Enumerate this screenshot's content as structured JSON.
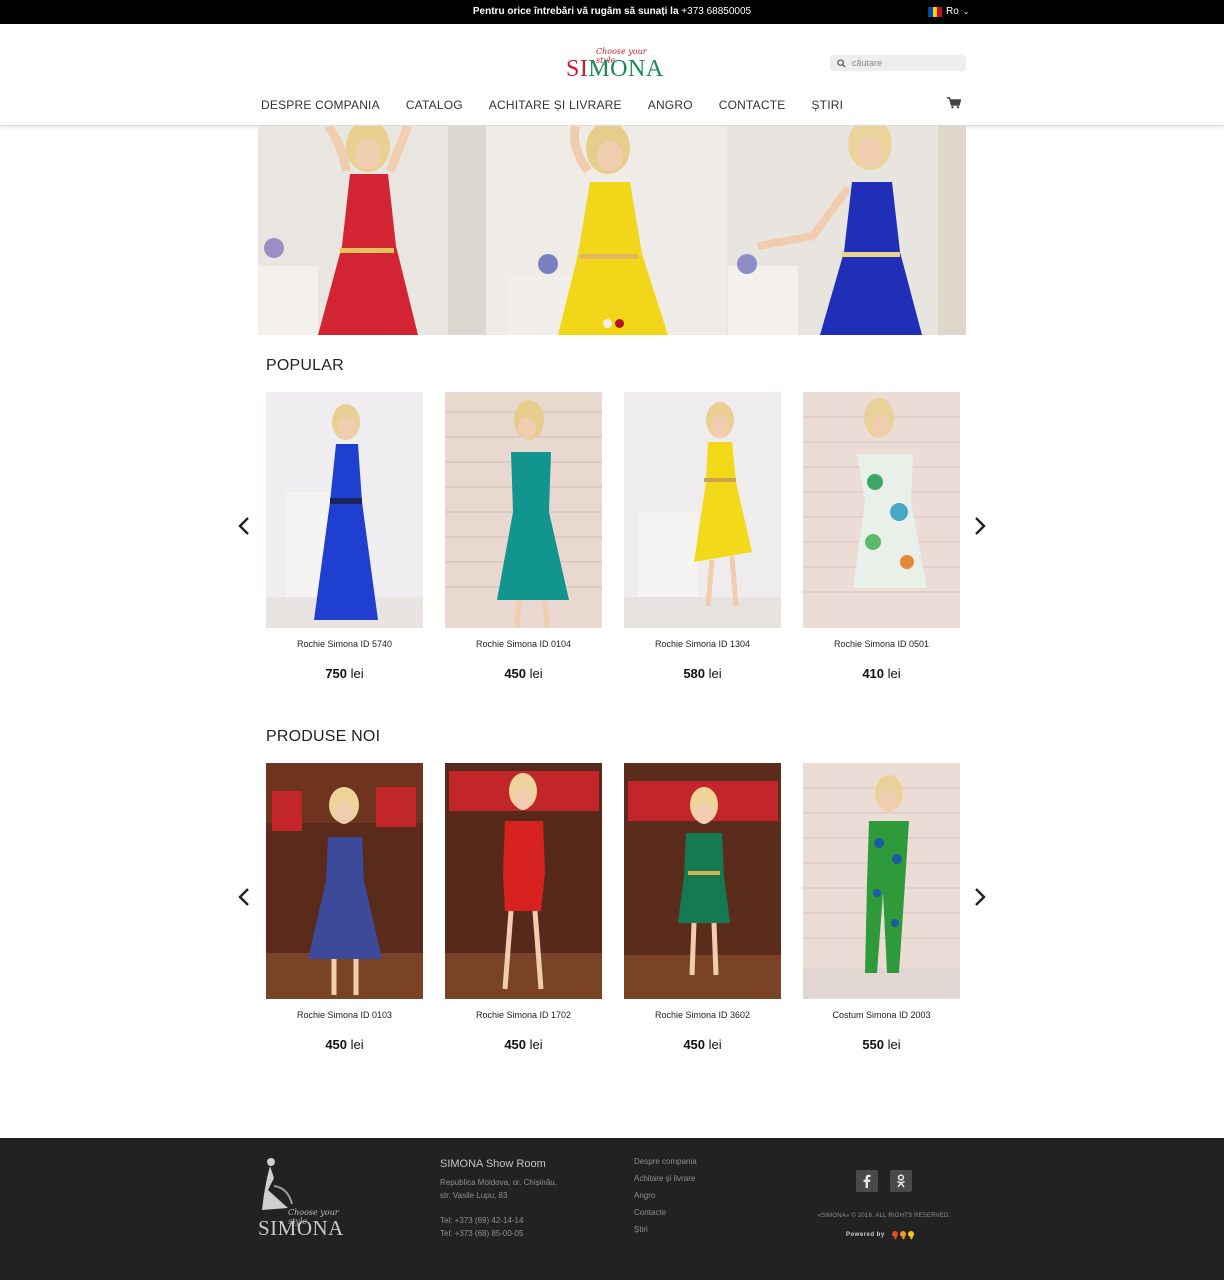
{
  "topbar": {
    "message": "Pentru orice întrebări vă rugăm să sunați la",
    "phone": "+373 68850005",
    "language": "Ro"
  },
  "header": {
    "logo_tagline": "Choose your style",
    "logo_name_first": "SI",
    "logo_name_rest": "MONA",
    "search_placeholder": "căutare",
    "nav": [
      "DESPRE COMPANIA",
      "CATALOG",
      "ACHITARE ȘI LIVRARE",
      "ANGRO",
      "CONTACTE",
      "ȘTIRI"
    ]
  },
  "sections": {
    "popular": {
      "title": "POPULAR",
      "products": [
        {
          "name": "Rochie Simona ID 5740",
          "price_value": "750",
          "currency": "lei",
          "dress_color": "#1f3fd0"
        },
        {
          "name": "Rochie Simona ID 0104",
          "price_value": "450",
          "currency": "lei",
          "dress_color": "#12958f"
        },
        {
          "name": "Rochie Simona ID 1304",
          "price_value": "580",
          "currency": "lei",
          "dress_color": "#f2d91a"
        },
        {
          "name": "Rochie Simona ID 0501",
          "price_value": "410",
          "currency": "lei",
          "dress_color": "#e9efe9"
        }
      ]
    },
    "new": {
      "title": "PRODUSE NOI",
      "products": [
        {
          "name": "Rochie Simona ID 0103",
          "price_value": "450",
          "currency": "lei",
          "dress_color": "#3d4a9a"
        },
        {
          "name": "Rochie Simona ID 1702",
          "price_value": "450",
          "currency": "lei",
          "dress_color": "#d8221f"
        },
        {
          "name": "Rochie Simona ID 3602",
          "price_value": "450",
          "currency": "lei",
          "dress_color": "#137a52"
        },
        {
          "name": "Costum Simona ID 2003",
          "price_value": "550",
          "currency": "lei",
          "dress_color": "#2e9a3a"
        }
      ]
    }
  },
  "footer": {
    "logo_tagline": "Choose your style",
    "logo_name": "SIMONA",
    "showroom_title": "SIMONA Show Room",
    "address_line1": "Republica Moldova, or. Chișinău,",
    "address_line2": "str. Vasile Lupu, 83",
    "tel1": "Tel: +373 (69) 42-14-14",
    "tel2": "Tel: +373 (68) 85-00-05",
    "links": [
      "Despre compania",
      "Achitare și livrare",
      "Angro",
      "Contacte",
      "Știri"
    ],
    "copyright": "«SIMONA» © 2016. ALL RIGHTS RESERVED.",
    "powered": "Powered by"
  },
  "colors": {
    "brand_green": "#1b8a5a",
    "brand_red": "#c71c2c",
    "topbar_bg": "#000000",
    "footer_bg": "#222222"
  },
  "icons": {
    "search": "search-icon",
    "cart": "shopping-cart-icon",
    "prev": "chevron-left-icon",
    "next": "chevron-right-icon",
    "facebook": "facebook-icon",
    "odnoklassniki": "odnoklassniki-icon"
  }
}
